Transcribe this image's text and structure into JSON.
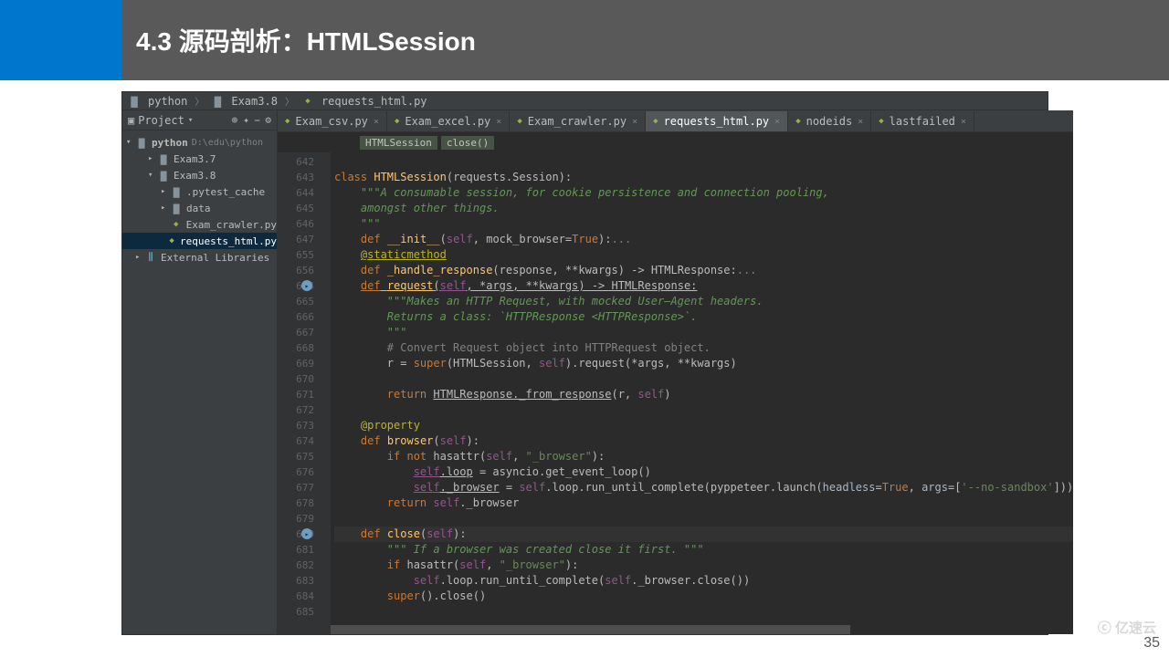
{
  "slide": {
    "title": "4.3 源码剖析：HTMLSession",
    "pageNumber": "35",
    "watermark": "ⓒ 亿速云"
  },
  "navCrumbs": [
    "python",
    "Exam3.8",
    "requests_html.py"
  ],
  "projectPanel": {
    "title": "Project",
    "tree": {
      "root": "python",
      "rootPath": "D:\\edu\\python",
      "items": [
        {
          "depth": 1,
          "caret": "▸",
          "icon": "folder",
          "text": "Exam3.7"
        },
        {
          "depth": 1,
          "caret": "▾",
          "icon": "folder",
          "text": "Exam3.8"
        },
        {
          "depth": 2,
          "caret": "▸",
          "icon": "folder",
          "text": ".pytest_cache"
        },
        {
          "depth": 2,
          "caret": "▸",
          "icon": "folder",
          "text": "data"
        },
        {
          "depth": 2,
          "caret": "",
          "icon": "py",
          "text": "Exam_crawler.py"
        },
        {
          "depth": 2,
          "caret": "",
          "icon": "py",
          "text": "requests_html.py",
          "selected": true
        },
        {
          "depth": 0,
          "caret": "▸",
          "icon": "lib",
          "text": "External Libraries"
        }
      ]
    }
  },
  "tabs": [
    {
      "label": "Exam_csv.py",
      "active": false
    },
    {
      "label": "Exam_excel.py",
      "active": false
    },
    {
      "label": "Exam_crawler.py",
      "active": false
    },
    {
      "label": "requests_html.py",
      "active": true
    },
    {
      "label": "nodeids",
      "active": false
    },
    {
      "label": "lastfailed",
      "active": false
    }
  ],
  "fnCrumbs": [
    "HTMLSession",
    "close()"
  ],
  "code": {
    "startLine": 642,
    "lines": [
      {
        "n": 642,
        "html": ""
      },
      {
        "n": 643,
        "html": "<span class='kw'>class</span> <span class='fn'>HTMLSession</span>(requests.Session):"
      },
      {
        "n": 644,
        "html": "    <span class='doc'>\"\"\"A consumable session, for cookie persistence and connection pooling,</span>"
      },
      {
        "n": 645,
        "html": "    <span class='doc'>amongst other things.</span>"
      },
      {
        "n": 646,
        "html": "    <span class='doc'>\"\"\"</span>"
      },
      {
        "n": 647,
        "html": "    <span class='kw'>def</span> <span class='fn'>__init__</span>(<span class='self'>self</span>, mock_browser=<span class='kw'>True</span>):<span class='cmt'>...</span>"
      },
      {
        "n": 655,
        "html": "    <span class='dec under'>@staticmethod</span>"
      },
      {
        "n": 656,
        "html": "    <span class='kw'>def</span> <span class='fn'>_handle_response</span>(response, **kwargs) -&gt; HTMLResponse:<span class='cmt'>...</span>"
      },
      {
        "n": 664,
        "marker": true,
        "html": "    <span class='kw under'>def</span><span class='under'> </span><span class='fn under'>request</span><span class='under'>(</span><span class='self under'>self</span><span class='under'>, *args, **kwargs) -&gt; HTMLResponse:</span>"
      },
      {
        "n": 665,
        "html": "        <span class='doc'>\"\"\"Makes an HTTP Request, with mocked User–Agent headers.</span>"
      },
      {
        "n": 666,
        "html": "        <span class='doc'>Returns a class: `HTTPResponse &lt;HTTPResponse&gt;`.</span>"
      },
      {
        "n": 667,
        "html": "        <span class='doc'>\"\"\"</span>"
      },
      {
        "n": 668,
        "html": "        <span class='cmt'># Convert Request object into HTTPRequest object.</span>"
      },
      {
        "n": 669,
        "html": "        r = <span class='kw'>super</span>(HTMLSession, <span class='self'>self</span>).request(*args, **kwargs)"
      },
      {
        "n": 670,
        "html": ""
      },
      {
        "n": 671,
        "html": "        <span class='kw'>return</span> <span class='under'>HTMLResponse._from_response</span>(r, <span class='self'>self</span>)"
      },
      {
        "n": 672,
        "html": ""
      },
      {
        "n": 673,
        "html": "    <span class='dec'>@property</span>"
      },
      {
        "n": 674,
        "html": "    <span class='kw'>def</span> <span class='fn'>browser</span>(<span class='self'>self</span>):"
      },
      {
        "n": 675,
        "html": "        <span class='kw'>if not</span> hasattr(<span class='self'>self</span>, <span class='str'>\"_browser\"</span>):"
      },
      {
        "n": 676,
        "html": "            <span class='self under'>self</span><span class='under'>.loop</span> = asyncio.get_event_loop()"
      },
      {
        "n": 677,
        "html": "            <span class='self under'>self</span><span class='under'>._browser</span> = <span class='self'>self</span>.loop.run_until_complete(pyppeteer.launch(<span class='param'>headless</span>=<span class='kw'>True</span>, <span class='param'>args</span>=[<span class='str'>'--no-sandbox'</span>]))"
      },
      {
        "n": 678,
        "html": "        <span class='kw'>return</span> <span class='self'>self</span>._browser"
      },
      {
        "n": 679,
        "html": ""
      },
      {
        "n": 680,
        "marker": true,
        "caret": true,
        "html": "    <span class='kw'>def</span> <span class='fn'>close</span>(<span class='self'>self</span>):"
      },
      {
        "n": 681,
        "html": "        <span class='doc'>\"\"\" If a browser was created close it first. \"\"\"</span>"
      },
      {
        "n": 682,
        "html": "        <span class='kw'>if</span> hasattr(<span class='self'>self</span>, <span class='str'>\"_browser\"</span>):"
      },
      {
        "n": 683,
        "html": "            <span class='self'>self</span>.loop.run_until_complete(<span class='self'>self</span>._browser.close())"
      },
      {
        "n": 684,
        "html": "        <span class='kw'>super</span>().close()"
      },
      {
        "n": 685,
        "html": ""
      }
    ]
  }
}
